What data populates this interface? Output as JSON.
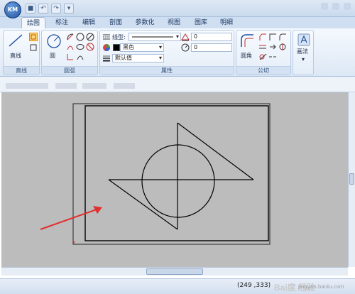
{
  "app": {
    "logo_text": "KM"
  },
  "tabs": [
    "绘图",
    "标注",
    "编辑",
    "剖面",
    "参数化",
    "视图",
    "图库",
    "明细"
  ],
  "active_tab": 0,
  "groups": {
    "line": {
      "label": "直线",
      "button": "直线"
    },
    "arc": {
      "label": "圆弧",
      "button": "圆"
    },
    "props": {
      "label": "属性",
      "linetype_label": "线型:",
      "color_value": "黑色",
      "lineweight_value": "默认值",
      "width_value": "0",
      "angle_value": "0"
    },
    "fillet": {
      "label": "公切",
      "button": "圆角"
    },
    "draw_method": {
      "button": "画法"
    }
  },
  "status": {
    "coords": "(249 ,333)"
  },
  "watermark": {
    "brand": "Bai度 经验",
    "url": "jingyan.baidu.com"
  },
  "colors": {
    "canvas": "#bcbcbc",
    "arrow": "#e03030",
    "ribbon_accent": "#1f4f9e"
  }
}
